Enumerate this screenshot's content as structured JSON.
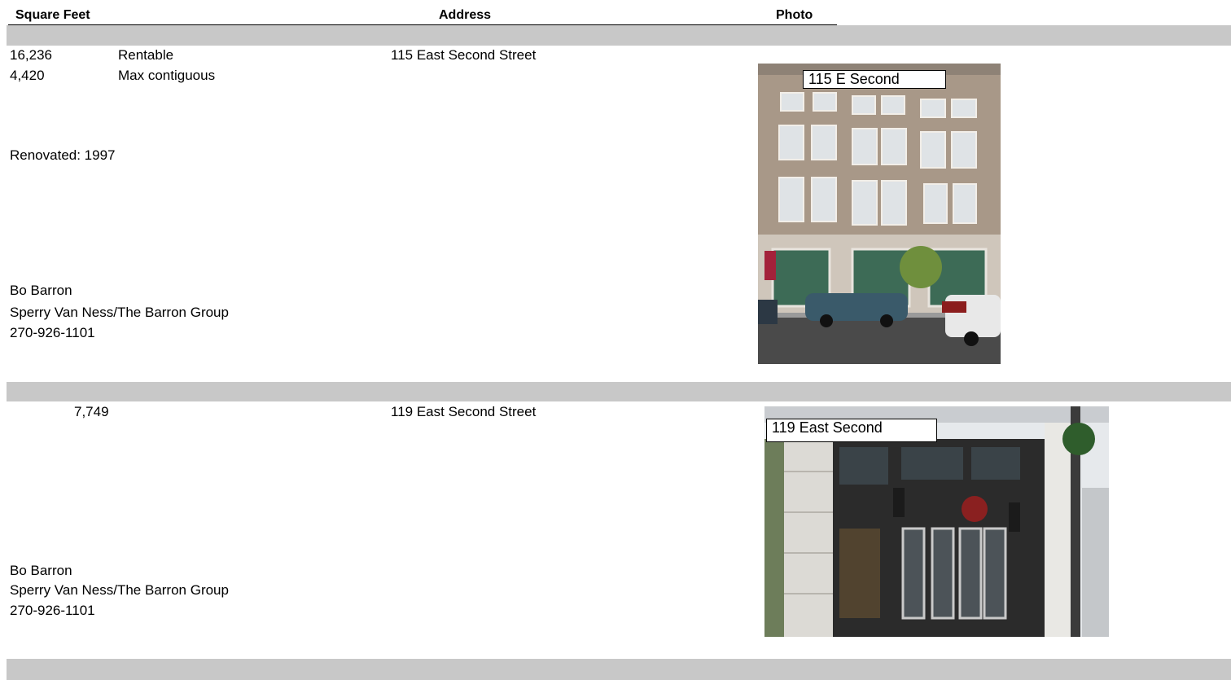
{
  "headers": {
    "square_feet": "Square Feet",
    "address": "Address",
    "photo": "Photo"
  },
  "listings": [
    {
      "sqft_rentable": "16,236",
      "sqft_rentable_label": "Rentable",
      "sqft_max": "4,420",
      "sqft_max_label": "Max contiguous",
      "renovated": "Renovated: 1997",
      "address": "115 East Second Street",
      "contact_name": "Bo Barron",
      "contact_company": "Sperry Van Ness/The Barron Group",
      "contact_phone": "270-926-1101",
      "photo_label": "115 E Second"
    },
    {
      "sqft": "7,749",
      "address": "119 East Second Street",
      "contact_name": "Bo Barron",
      "contact_company": "Sperry Van Ness/The Barron Group",
      "contact_phone": "270-926-1101",
      "photo_label": "119 East Second"
    }
  ],
  "colors": {
    "band": "#c8c8c8"
  }
}
